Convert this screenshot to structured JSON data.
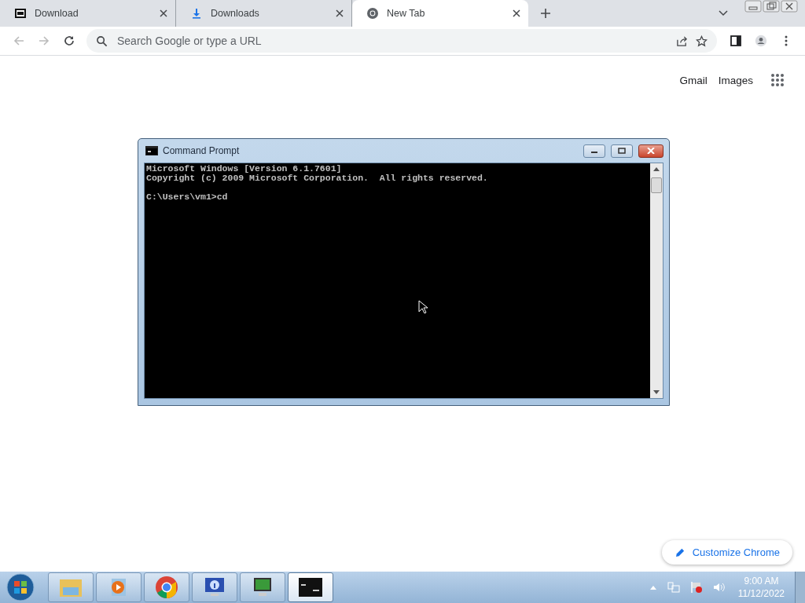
{
  "browser": {
    "tabs": [
      {
        "title": "Download",
        "kind": "archive",
        "selected": false
      },
      {
        "title": "Downloads",
        "kind": "download",
        "selected": false
      },
      {
        "title": "New Tab",
        "kind": "chrome",
        "selected": true
      }
    ],
    "omnibox": {
      "placeholder": "Search Google or type a URL"
    },
    "header_links": [
      "Gmail",
      "Images"
    ],
    "customize_button": "Customize Chrome"
  },
  "console": {
    "title": "Command Prompt",
    "output": [
      "Microsoft Windows [Version 6.1.7601]",
      "Copyright (c) 2009 Microsoft Corporation.  All rights reserved."
    ],
    "prompt": "C:\\Users\\vm1>cd"
  },
  "taskbar": {
    "apps": [
      {
        "kind": "folder",
        "selected": false
      },
      {
        "kind": "media",
        "selected": false
      },
      {
        "kind": "chrome",
        "selected": false
      },
      {
        "kind": "info",
        "selected": false
      },
      {
        "kind": "monitor",
        "selected": false
      },
      {
        "kind": "console",
        "selected": true
      }
    ],
    "clock": {
      "time": "9:00 AM",
      "date": "11/12/2022"
    }
  }
}
